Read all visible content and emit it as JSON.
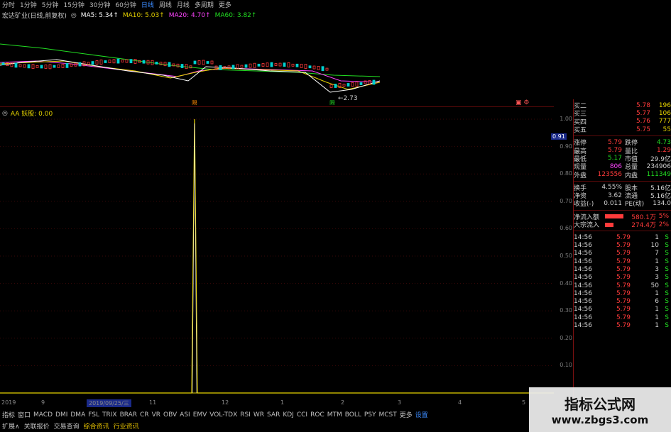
{
  "topbar": {
    "periods": [
      "分时",
      "1分钟",
      "5分钟",
      "15分钟",
      "30分钟",
      "60分钟",
      "日线",
      "周线",
      "月线",
      "多周期",
      "更多"
    ],
    "active_period": "日线"
  },
  "ma_line": {
    "stock": "宏达矿业(日线,前复权)",
    "ma5": "MA5: 5.34↑",
    "ma10": "MA10: 5.03↑",
    "ma20": "MA20: 4.70↑",
    "ma60": "MA60: 3.82↑",
    "colors": {
      "ma5": "#ffffff",
      "ma10": "#e6d200",
      "ma20": "#ff44ff",
      "ma60": "#22dd22"
    }
  },
  "kchart": {
    "low_label": "←2.73",
    "marker_left": "限",
    "marker_right": "限"
  },
  "indicator": {
    "title": "AA 妖股: 0.00",
    "value_box": "0.91",
    "axis_ticks": [
      "1.00",
      "0.90",
      "0.80",
      "0.70",
      "0.60",
      "0.50",
      "0.40",
      "0.30",
      "0.20",
      "0.10"
    ]
  },
  "date_axis": {
    "labels": [
      "2019",
      "9",
      "2019/09/25/三",
      "11",
      "12",
      "1",
      "2",
      "3",
      "4",
      "5"
    ]
  },
  "tabs_row1": [
    "指标",
    "窗口",
    "MACD",
    "DMI",
    "DMA",
    "FSL",
    "TRIX",
    "BRAR",
    "CR",
    "VR",
    "OBV",
    "ASI",
    "EMV",
    "VOL-TDX",
    "RSI",
    "WR",
    "SAR",
    "KDJ",
    "CCI",
    "ROC",
    "MTM",
    "BOLL",
    "PSY",
    "MCST",
    "更多",
    "设置"
  ],
  "tabs_row2": [
    "扩展∧",
    "关联报价",
    "交易查询",
    "综合资讯",
    "行业资讯"
  ],
  "quote": {
    "buy_rows": [
      {
        "label": "买二",
        "price": "5.78",
        "vol": "196"
      },
      {
        "label": "买三",
        "price": "5.77",
        "vol": "106"
      },
      {
        "label": "买四",
        "price": "5.76",
        "vol": "777"
      },
      {
        "label": "买五",
        "price": "5.75",
        "vol": "55"
      }
    ],
    "stats": [
      {
        "l1": "涨停",
        "v1": "5.79",
        "l2": "跌停",
        "v2": "4.73"
      },
      {
        "l1": "最高",
        "v1": "5.79",
        "l2": "量比",
        "v2": "1.29"
      },
      {
        "l1": "最低",
        "v1": "5.17",
        "l2": "市值",
        "v2": "29.9亿"
      },
      {
        "l1": "现量",
        "v1": "806",
        "l2": "总量",
        "v2": "234906"
      },
      {
        "l1": "外盘",
        "v1": "123556",
        "l2": "内盘",
        "v2": "111349"
      }
    ],
    "stats2": [
      {
        "l1": "换手",
        "v1": "4.55%",
        "l2": "股本",
        "v2": "5.16亿"
      },
      {
        "l1": "净资",
        "v1": "3.62",
        "l2": "流通",
        "v2": "5.16亿"
      },
      {
        "l1": "收益(-)",
        "v1": "0.011",
        "l2": "PE(动)",
        "v2": "134.0"
      }
    ],
    "flow": [
      {
        "label": "净流入额",
        "value": "580.1万",
        "pct": "5%"
      },
      {
        "label": "大宗流入",
        "value": "274.4万",
        "pct": "2%"
      }
    ],
    "ticks": [
      {
        "t": "14:56",
        "p": "5.79",
        "v": "1",
        "d": "S"
      },
      {
        "t": "14:56",
        "p": "5.79",
        "v": "10",
        "d": "S"
      },
      {
        "t": "14:56",
        "p": "5.79",
        "v": "7",
        "d": "S"
      },
      {
        "t": "14:56",
        "p": "5.79",
        "v": "1",
        "d": "S"
      },
      {
        "t": "14:56",
        "p": "5.79",
        "v": "3",
        "d": "S"
      },
      {
        "t": "14:56",
        "p": "5.79",
        "v": "3",
        "d": "S"
      },
      {
        "t": "14:56",
        "p": "5.79",
        "v": "50",
        "d": "S"
      },
      {
        "t": "14:56",
        "p": "5.79",
        "v": "1",
        "d": "S"
      },
      {
        "t": "14:56",
        "p": "5.79",
        "v": "6",
        "d": "S"
      },
      {
        "t": "14:56",
        "p": "5.79",
        "v": "1",
        "d": "S"
      },
      {
        "t": "14:56",
        "p": "5.79",
        "v": "1",
        "d": "S"
      },
      {
        "t": "14:56",
        "p": "5.79",
        "v": "1",
        "d": "S"
      }
    ]
  },
  "watermark": {
    "line1": "指标公式网",
    "line2": "www.zbgs3.com"
  }
}
